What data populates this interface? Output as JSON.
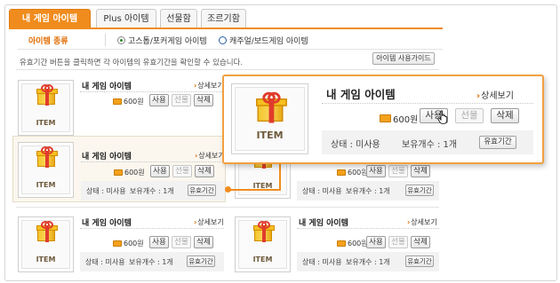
{
  "tabs": [
    {
      "label": "내 게임 아이템",
      "active": true
    },
    {
      "label": "Plus 아이템",
      "active": false
    },
    {
      "label": "선물함",
      "active": false
    },
    {
      "label": "조르기함",
      "active": false
    }
  ],
  "filter": {
    "label": "아이템 종류",
    "options": [
      {
        "label": "고스톱/포커게임 아이템",
        "selected": true
      },
      {
        "label": "캐주얼/보드게임 아이템",
        "selected": false
      }
    ]
  },
  "notice": "유효기간 버튼을 클릭하면 각 아이템의 유효기간을 확인할 수 있습니다.",
  "guide_button": "아이템 사용가이드",
  "item": {
    "thumb_text": "ITEM",
    "name": "내 게임 아이템",
    "more": "상세보기",
    "price": "600원",
    "use": "사용",
    "gift": "선물",
    "delete": "삭제",
    "status": "상태 : 미사용",
    "count": "보유개수 : 1개",
    "period": "유효기간"
  },
  "colors": {
    "accent": "#f08c1e",
    "highlight_border": "#f2a040"
  },
  "icons": [
    "gift-icon",
    "coin-icon",
    "radio-icon",
    "cursor-hand-icon",
    "chevron-right-icon"
  ]
}
